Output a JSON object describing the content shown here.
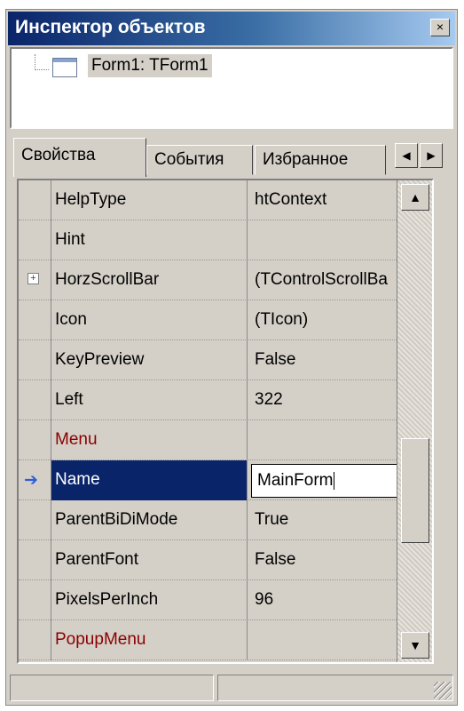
{
  "window": {
    "title": "Инспектор объектов",
    "close_glyph": "×"
  },
  "tree": {
    "node_label": "Form1: TForm1"
  },
  "tabs": [
    {
      "label": "Свойства"
    },
    {
      "label": "События"
    },
    {
      "label": "Избранное"
    }
  ],
  "tab_nav": {
    "left_glyph": "◀",
    "right_glyph": "▶"
  },
  "properties": [
    {
      "name": "HelpType",
      "value": "htContext"
    },
    {
      "name": "Hint",
      "value": ""
    },
    {
      "name": "HorzScrollBar",
      "value": "(TControlScrollBa"
    },
    {
      "name": "Icon",
      "value": "(TIcon)"
    },
    {
      "name": "KeyPreview",
      "value": "False"
    },
    {
      "name": "Left",
      "value": "322"
    },
    {
      "name": "Menu",
      "value": ""
    },
    {
      "name": "Name",
      "value": "MainForm"
    },
    {
      "name": "ParentBiDiMode",
      "value": "True"
    },
    {
      "name": "ParentFont",
      "value": "False"
    },
    {
      "name": "PixelsPerInch",
      "value": "96"
    },
    {
      "name": "PopupMenu",
      "value": ""
    }
  ],
  "icons": {
    "expand": "+",
    "selected_row_marker": "➔",
    "scroll_up": "▲",
    "scroll_down": "▼"
  },
  "colors": {
    "title_start": "#0a246a",
    "selection": "#0a246a",
    "event_property": "#8b0000",
    "face": "#d4d0c8"
  }
}
